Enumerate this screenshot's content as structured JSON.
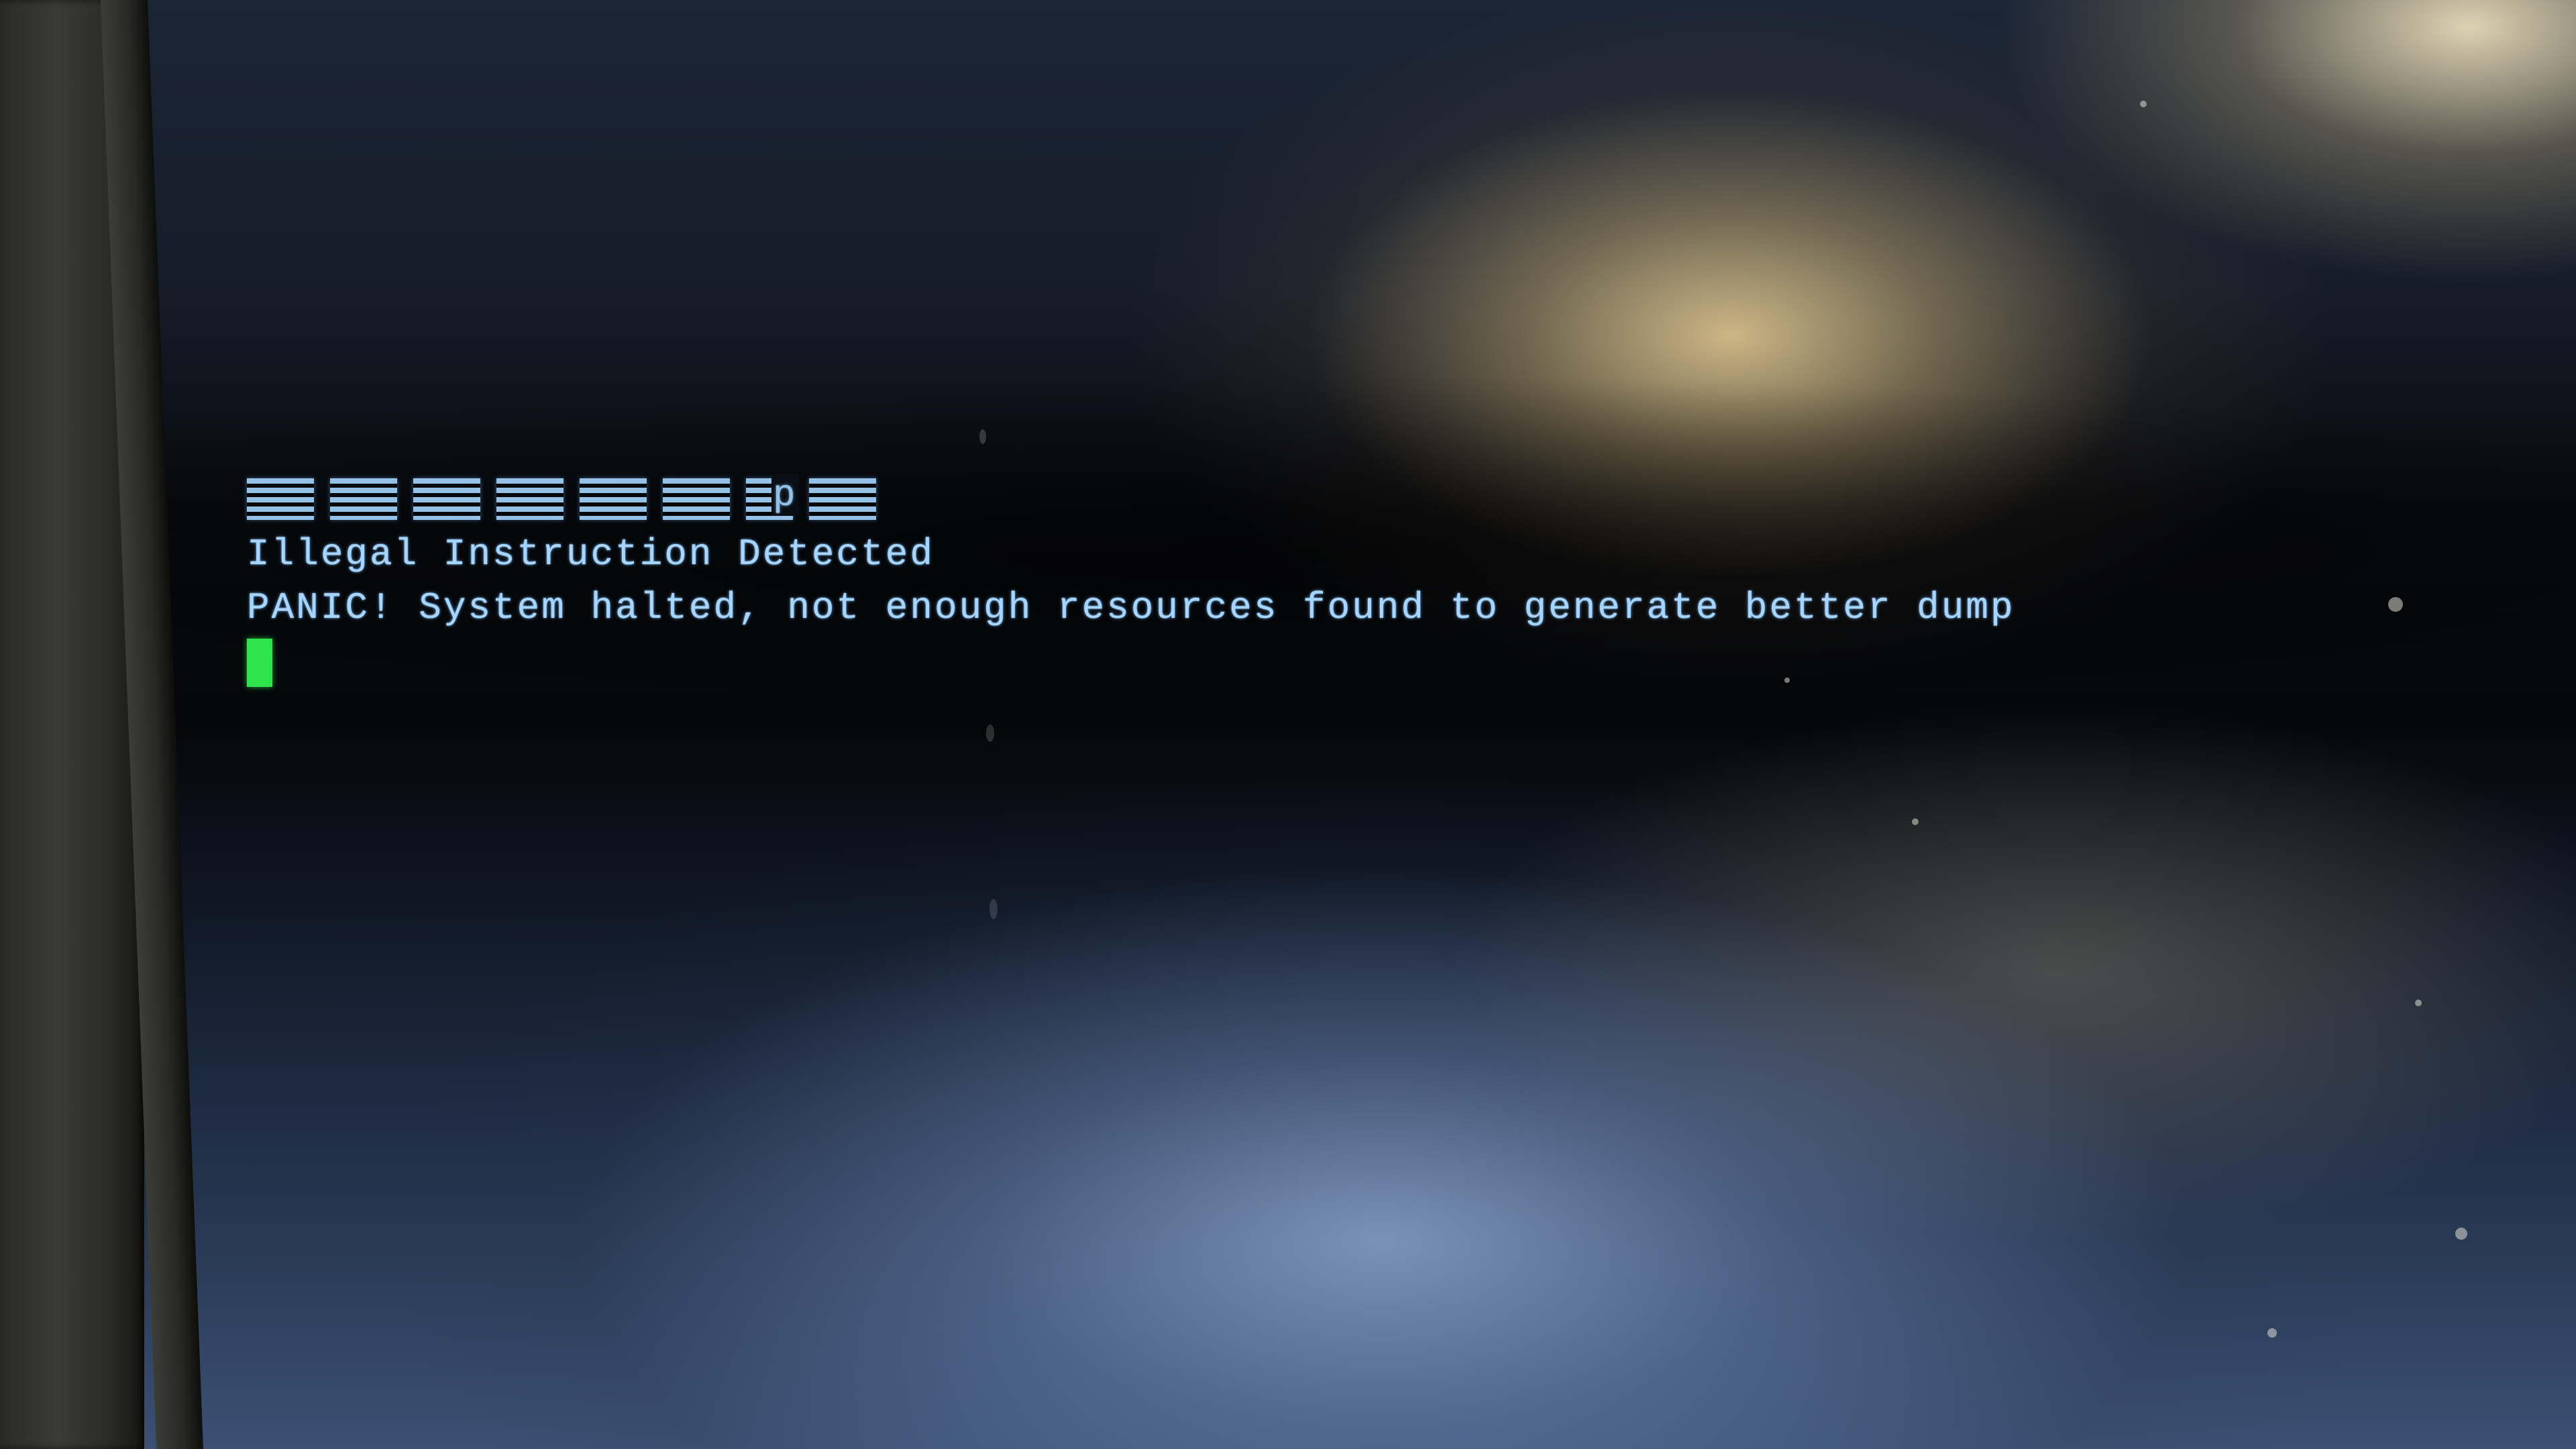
{
  "terminal": {
    "logo_mark": "p",
    "lines": [
      "Illegal Instruction Detected",
      "PANIC! System halted, not enough resources found to generate better dump"
    ],
    "text_color": "#a6d6ff",
    "cursor_color": "#2fe34a",
    "background_color": "#0c1018"
  }
}
